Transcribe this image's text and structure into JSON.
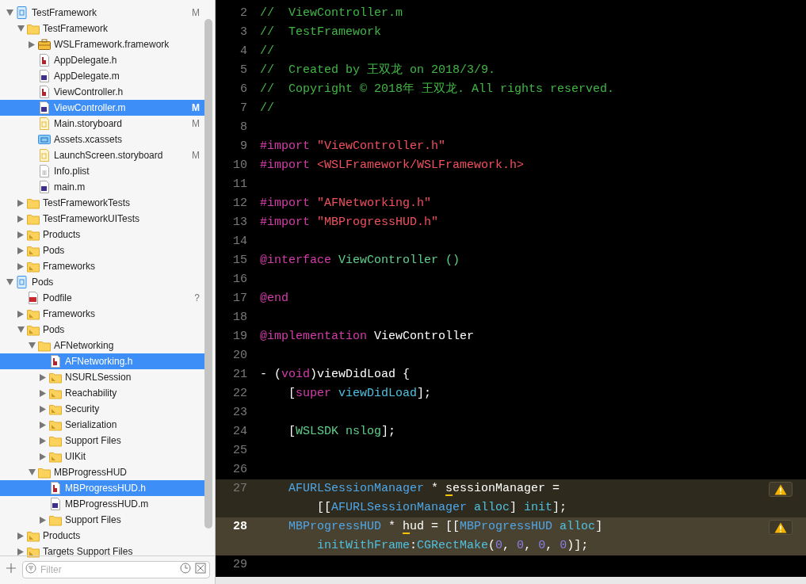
{
  "navigator": {
    "items": [
      {
        "label": "TestFramework",
        "kind": "project",
        "expanded": true,
        "selected": false,
        "status": "M",
        "children": [
          {
            "label": "TestFramework",
            "kind": "folder",
            "expanded": true,
            "selected": false,
            "children": [
              {
                "label": "WSLFramework.framework",
                "kind": "framework",
                "expanded": false,
                "selected": false
              },
              {
                "label": "AppDelegate.h",
                "kind": "header",
                "selected": false
              },
              {
                "label": "AppDelegate.m",
                "kind": "source",
                "selected": false
              },
              {
                "label": "ViewController.h",
                "kind": "header",
                "selected": false
              },
              {
                "label": "ViewController.m",
                "kind": "source",
                "selected": true,
                "status": "M"
              },
              {
                "label": "Main.storyboard",
                "kind": "storyboard",
                "selected": false,
                "status": "M"
              },
              {
                "label": "Assets.xcassets",
                "kind": "assets",
                "selected": false
              },
              {
                "label": "LaunchScreen.storyboard",
                "kind": "storyboard",
                "selected": false,
                "status": "M"
              },
              {
                "label": "Info.plist",
                "kind": "plist",
                "selected": false
              },
              {
                "label": "main.m",
                "kind": "source",
                "selected": false
              }
            ]
          },
          {
            "label": "TestFrameworkTests",
            "kind": "folder",
            "expanded": false,
            "selected": false
          },
          {
            "label": "TestFrameworkUITests",
            "kind": "folder",
            "expanded": false,
            "selected": false
          },
          {
            "label": "Products",
            "kind": "group",
            "expanded": false,
            "selected": false
          },
          {
            "label": "Pods",
            "kind": "group",
            "expanded": false,
            "selected": false
          },
          {
            "label": "Frameworks",
            "kind": "group",
            "expanded": false,
            "selected": false
          }
        ]
      },
      {
        "label": "Pods",
        "kind": "project",
        "expanded": true,
        "selected": false,
        "children": [
          {
            "label": "Podfile",
            "kind": "ruby",
            "selected": false,
            "status": "?"
          },
          {
            "label": "Frameworks",
            "kind": "group",
            "expanded": false,
            "selected": false
          },
          {
            "label": "Pods",
            "kind": "group",
            "expanded": true,
            "selected": false,
            "children": [
              {
                "label": "AFNetworking",
                "kind": "folder",
                "expanded": true,
                "selected": false,
                "children": [
                  {
                    "label": "AFNetworking.h",
                    "kind": "header",
                    "selected": true
                  },
                  {
                    "label": "NSURLSession",
                    "kind": "group",
                    "expanded": false,
                    "selected": false
                  },
                  {
                    "label": "Reachability",
                    "kind": "group",
                    "expanded": false,
                    "selected": false
                  },
                  {
                    "label": "Security",
                    "kind": "group",
                    "expanded": false,
                    "selected": false
                  },
                  {
                    "label": "Serialization",
                    "kind": "group",
                    "expanded": false,
                    "selected": false
                  },
                  {
                    "label": "Support Files",
                    "kind": "folder",
                    "expanded": false,
                    "selected": false
                  },
                  {
                    "label": "UIKit",
                    "kind": "group",
                    "expanded": false,
                    "selected": false
                  }
                ]
              },
              {
                "label": "MBProgressHUD",
                "kind": "folder",
                "expanded": true,
                "selected": false,
                "children": [
                  {
                    "label": "MBProgressHUD.h",
                    "kind": "header",
                    "selected": true
                  },
                  {
                    "label": "MBProgressHUD.m",
                    "kind": "source",
                    "selected": false
                  },
                  {
                    "label": "Support Files",
                    "kind": "folder",
                    "expanded": false,
                    "selected": false
                  }
                ]
              }
            ]
          },
          {
            "label": "Products",
            "kind": "group",
            "expanded": false,
            "selected": false
          },
          {
            "label": "Targets Support Files",
            "kind": "group",
            "expanded": false,
            "selected": false
          }
        ]
      }
    ],
    "filter": {
      "placeholder": "Filter"
    }
  },
  "editor": {
    "lines": [
      {
        "number": "2",
        "rows": [
          {
            "spans": [
              {
                "kind": "comment",
                "text": "//  ViewController.m"
              }
            ]
          }
        ]
      },
      {
        "number": "3",
        "rows": [
          {
            "spans": [
              {
                "kind": "comment",
                "text": "//  TestFramework"
              }
            ]
          }
        ]
      },
      {
        "number": "4",
        "rows": [
          {
            "spans": [
              {
                "kind": "comment",
                "text": "//"
              }
            ]
          }
        ]
      },
      {
        "number": "5",
        "rows": [
          {
            "spans": [
              {
                "kind": "comment",
                "text": "//  Created by 王双龙 on 2018/3/9."
              }
            ]
          }
        ]
      },
      {
        "number": "6",
        "rows": [
          {
            "spans": [
              {
                "kind": "comment",
                "text": "//  Copyright © 2018年 王双龙. All rights reserved."
              }
            ]
          }
        ]
      },
      {
        "number": "7",
        "rows": [
          {
            "spans": [
              {
                "kind": "comment",
                "text": "//"
              }
            ]
          }
        ]
      },
      {
        "number": "8"
      },
      {
        "number": "9",
        "rows": [
          {
            "spans": [
              {
                "kind": "keyword",
                "text": "#import "
              },
              {
                "kind": "string",
                "text": "\"ViewController.h\""
              }
            ]
          }
        ]
      },
      {
        "number": "10",
        "rows": [
          {
            "spans": [
              {
                "kind": "keyword",
                "text": "#import "
              },
              {
                "kind": "string",
                "text": "<WSLFramework/WSLFramework.h>"
              }
            ]
          }
        ]
      },
      {
        "number": "11"
      },
      {
        "number": "12",
        "rows": [
          {
            "spans": [
              {
                "kind": "keyword",
                "text": "#import "
              },
              {
                "kind": "string",
                "text": "\"AFNetworking.h\""
              }
            ]
          }
        ]
      },
      {
        "number": "13",
        "rows": [
          {
            "spans": [
              {
                "kind": "keyword",
                "text": "#import "
              },
              {
                "kind": "string",
                "text": "\"MBProgressHUD.h\""
              }
            ]
          }
        ]
      },
      {
        "number": "14"
      },
      {
        "number": "15",
        "rows": [
          {
            "spans": [
              {
                "kind": "keyword",
                "text": "@interface "
              },
              {
                "kind": "project",
                "text": "ViewController ()"
              }
            ]
          }
        ]
      },
      {
        "number": "16"
      },
      {
        "number": "17",
        "rows": [
          {
            "spans": [
              {
                "kind": "keyword",
                "text": "@end"
              }
            ]
          }
        ]
      },
      {
        "number": "18"
      },
      {
        "number": "19",
        "rows": [
          {
            "spans": [
              {
                "kind": "keyword",
                "text": "@implementation "
              },
              {
                "kind": "plain",
                "text": "ViewController"
              }
            ]
          }
        ]
      },
      {
        "number": "20"
      },
      {
        "number": "21",
        "rows": [
          {
            "spans": [
              {
                "kind": "plain",
                "text": "- ("
              },
              {
                "kind": "keyword",
                "text": "void"
              },
              {
                "kind": "plain",
                "text": ")viewDidLoad {"
              }
            ]
          }
        ]
      },
      {
        "number": "22",
        "rows": [
          {
            "spans": [
              {
                "kind": "plain",
                "text": "    ["
              },
              {
                "kind": "keyword",
                "text": "super "
              },
              {
                "kind": "method",
                "text": "viewDidLoad"
              },
              {
                "kind": "plain",
                "text": "];"
              }
            ]
          }
        ]
      },
      {
        "number": "23"
      },
      {
        "number": "24",
        "rows": [
          {
            "spans": [
              {
                "kind": "plain",
                "text": "    ["
              },
              {
                "kind": "project",
                "text": "WSLSDK nslog"
              },
              {
                "kind": "plain",
                "text": "];"
              }
            ]
          }
        ]
      },
      {
        "number": "25"
      },
      {
        "number": "26"
      },
      {
        "number": "27",
        "warning": true,
        "current": false,
        "rows": [
          {
            "spans": [
              {
                "kind": "class",
                "text": "    AFURLSessionManager"
              },
              {
                "kind": "plain",
                "text": " * "
              },
              {
                "kind": "flagged",
                "text": "s"
              },
              {
                "kind": "plain",
                "text": "essionManager ="
              }
            ]
          },
          {
            "spans": [
              {
                "kind": "plain",
                "text": "        [["
              },
              {
                "kind": "class",
                "text": "AFURLSessionManager "
              },
              {
                "kind": "method",
                "text": "alloc"
              },
              {
                "kind": "plain",
                "text": "] "
              },
              {
                "kind": "method",
                "text": "init"
              },
              {
                "kind": "plain",
                "text": "];"
              }
            ]
          }
        ]
      },
      {
        "number": "28",
        "warning": true,
        "current": true,
        "rows": [
          {
            "spans": [
              {
                "kind": "class",
                "text": "    MBProgressHUD"
              },
              {
                "kind": "plain",
                "text": " * "
              },
              {
                "kind": "flagged",
                "text": "h"
              },
              {
                "kind": "plain",
                "text": "ud = [["
              },
              {
                "kind": "class",
                "text": "MBProgressHUD "
              },
              {
                "kind": "method",
                "text": "alloc"
              },
              {
                "kind": "plain",
                "text": "]"
              }
            ]
          },
          {
            "spans": [
              {
                "kind": "method",
                "text": "        initWithFrame"
              },
              {
                "kind": "plain",
                "text": ":"
              },
              {
                "kind": "method",
                "text": "CGRectMake"
              },
              {
                "kind": "plain",
                "text": "("
              },
              {
                "kind": "number",
                "text": "0"
              },
              {
                "kind": "plain",
                "text": ", "
              },
              {
                "kind": "number",
                "text": "0"
              },
              {
                "kind": "plain",
                "text": ", "
              },
              {
                "kind": "number",
                "text": "0"
              },
              {
                "kind": "plain",
                "text": ", "
              },
              {
                "kind": "number",
                "text": "0"
              },
              {
                "kind": "plain",
                "text": ")];"
              }
            ]
          }
        ]
      },
      {
        "number": "29"
      }
    ]
  }
}
